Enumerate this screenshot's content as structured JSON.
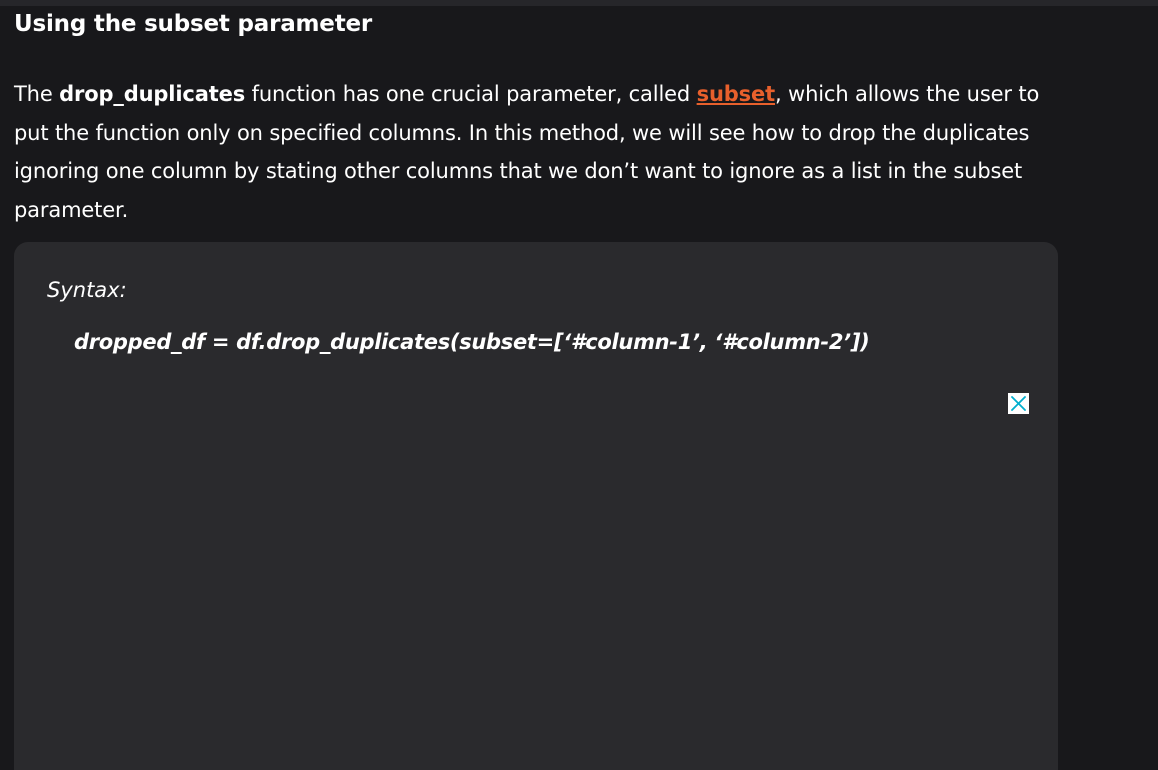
{
  "article": {
    "heading": "Using the subset parameter",
    "paragraph": {
      "part1": "The ",
      "bold_term": "drop_duplicates",
      "part2": " function has one crucial parameter, called ",
      "link_text": "subset",
      "part3": ", which allows the user to put the function only on specified columns. In this method, we will see how to drop the duplicates ignoring one column by stating other columns that we don’t want to ignore as a list in the subset parameter."
    },
    "syntax_label": "Syntax:",
    "syntax_code": "dropped_df = df.drop_duplicates(subset=[‘#column-1’, ‘#column-2’])"
  },
  "ad": {
    "close_icon": "close-icon",
    "close_icon_color": "#00aecd"
  },
  "colors": {
    "background": "#18181b",
    "code_box": "#2a2a2d",
    "link": "#e8602c"
  }
}
